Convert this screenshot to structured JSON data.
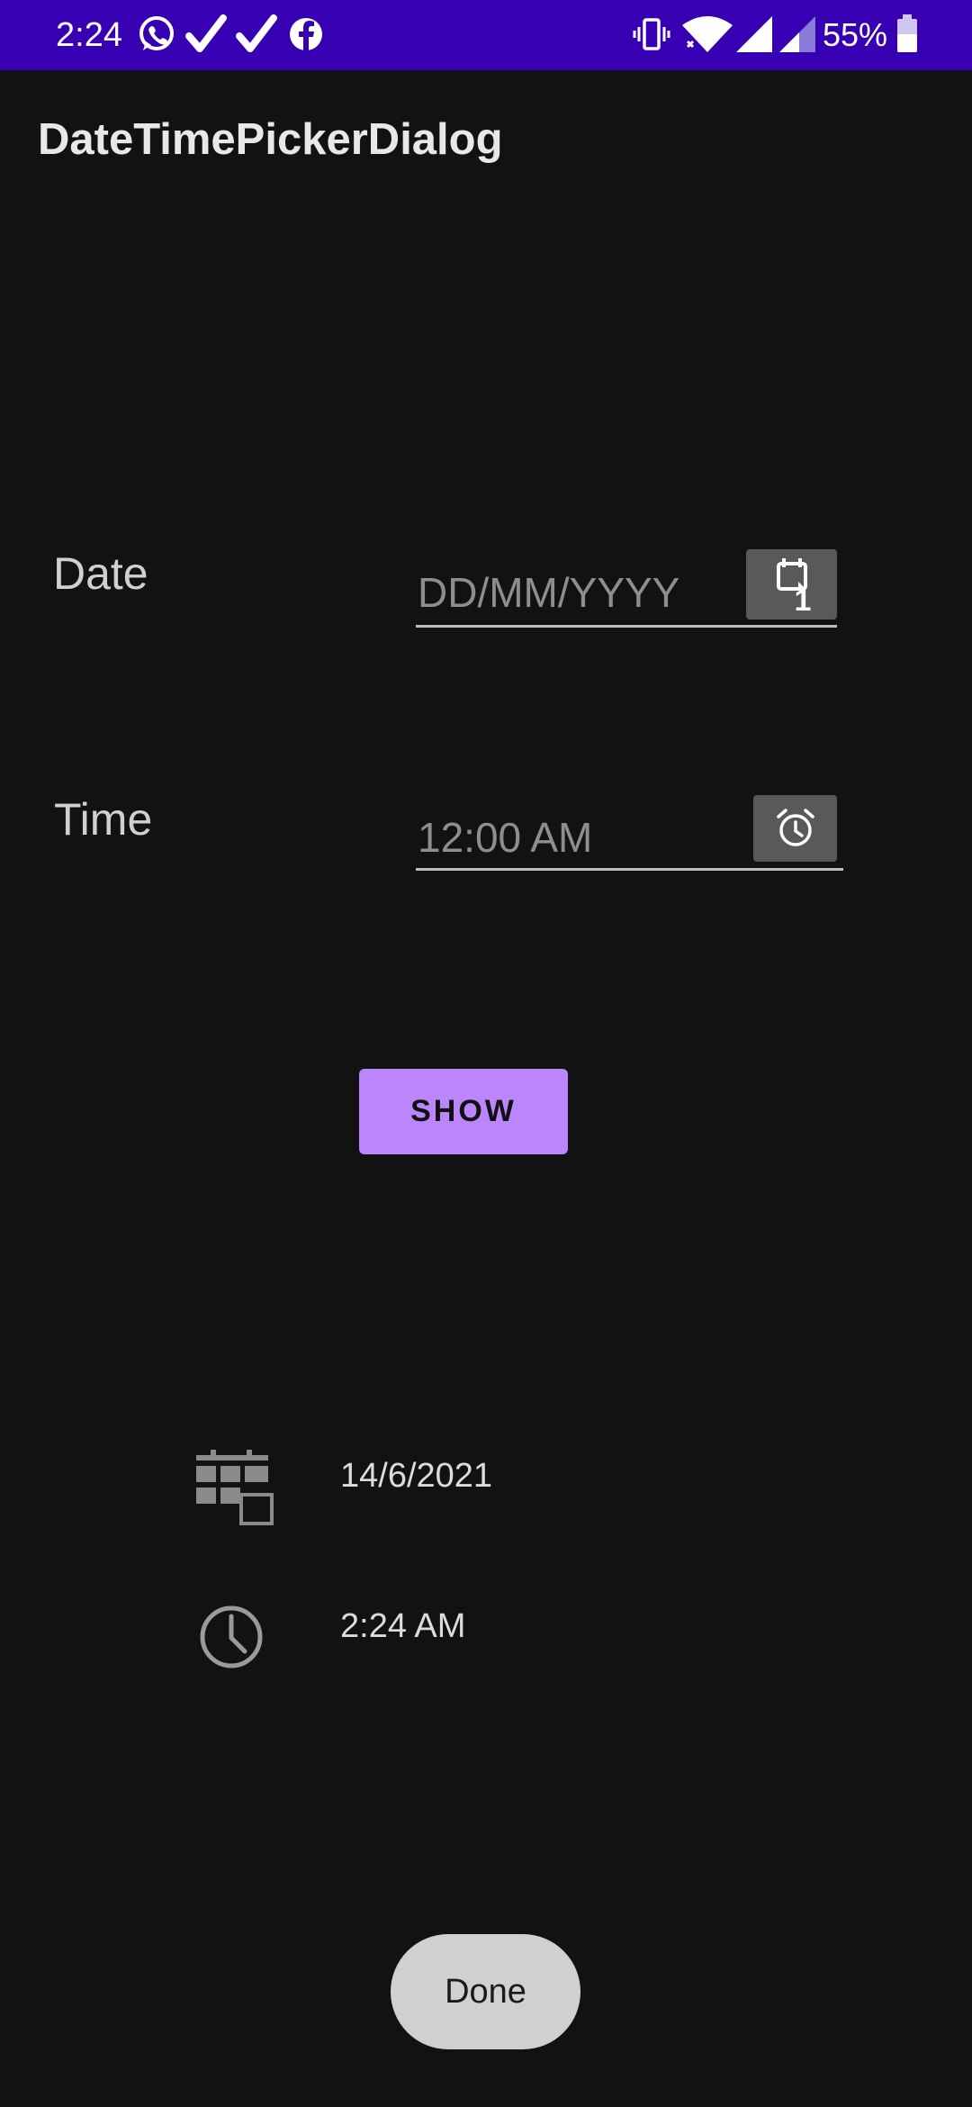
{
  "status_bar": {
    "time": "2:24",
    "battery_percent": "55%",
    "icons": [
      "whatsapp-icon",
      "check-icon",
      "check-icon",
      "facebook-icon",
      "vibrate-icon",
      "wifi-icon",
      "signal-icon",
      "signal-icon",
      "battery-icon"
    ],
    "background_color": "#3700b3"
  },
  "app_bar": {
    "title": "DateTimePickerDialog"
  },
  "form": {
    "date": {
      "label": "Date",
      "placeholder": "DD/MM/YYYY",
      "button_icon": "calendar-icon"
    },
    "time": {
      "label": "Time",
      "value": "12:00 AM",
      "button_icon": "alarm-clock-icon"
    }
  },
  "show_button": {
    "label": "SHOW",
    "color": "#bb86fc"
  },
  "results": {
    "date": {
      "icon": "calendar-grid-icon",
      "value": "14/6/2021"
    },
    "time": {
      "icon": "clock-icon",
      "value": "2:24 AM"
    }
  },
  "done_button": {
    "label": "Done"
  },
  "colors": {
    "background": "#121212",
    "accent": "#bb86fc"
  }
}
